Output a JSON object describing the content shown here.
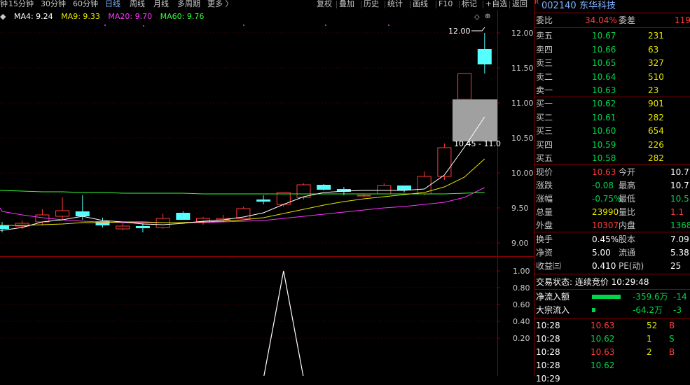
{
  "toolbar": {
    "left_items": [
      "钟",
      "15分钟",
      "30分钟",
      "60分钟",
      "日线",
      "周线",
      "月线",
      "多周期",
      "更多 〉"
    ],
    "active_item": "日线",
    "right_items": [
      "复权",
      "叠加",
      "历史",
      "统计",
      "画线",
      "F10",
      "标记",
      "+自选",
      "返回"
    ]
  },
  "legend": {
    "ma4": "MA4: 9.24",
    "ma9": "MA9: 9.33",
    "ma20": "MA20: 9.70",
    "ma60": "MA60: 9.76",
    "colors": {
      "ma4": "#ffffff",
      "ma9": "#e6e600",
      "ma20": "#ff33ff",
      "ma60": "#33ff33"
    }
  },
  "price_axis": [
    "12.00",
    "11.50",
    "11.00",
    "10.50",
    "10.00",
    "9.50",
    "9.00"
  ],
  "price_range": [
    8.95,
    12.14
  ],
  "vol_axis": [
    "1.00",
    "0.80",
    "0.60",
    "0.40",
    "0.20"
  ],
  "annotations": {
    "high_label": "12.00",
    "range_label": "10.45 - 11.0"
  },
  "chart_data": {
    "type": "candlestick",
    "candles": [
      {
        "o": 9.25,
        "h": 9.3,
        "l": 9.15,
        "c": 9.2
      },
      {
        "o": 9.24,
        "h": 9.32,
        "l": 9.2,
        "c": 9.28
      },
      {
        "o": 9.3,
        "h": 9.48,
        "l": 9.25,
        "c": 9.4
      },
      {
        "o": 9.38,
        "h": 9.65,
        "l": 9.33,
        "c": 9.46
      },
      {
        "o": 9.45,
        "h": 9.68,
        "l": 9.33,
        "c": 9.38
      },
      {
        "o": 9.31,
        "h": 9.36,
        "l": 9.22,
        "c": 9.25
      },
      {
        "o": 9.2,
        "h": 9.28,
        "l": 9.18,
        "c": 9.24
      },
      {
        "o": 9.24,
        "h": 9.28,
        "l": 9.15,
        "c": 9.21
      },
      {
        "o": 9.22,
        "h": 9.42,
        "l": 9.2,
        "c": 9.35
      },
      {
        "o": 9.43,
        "h": 9.45,
        "l": 9.33,
        "c": 9.33
      },
      {
        "o": 9.3,
        "h": 9.37,
        "l": 9.26,
        "c": 9.35
      },
      {
        "o": 9.33,
        "h": 9.4,
        "l": 9.3,
        "c": 9.35
      },
      {
        "o": 9.35,
        "h": 9.52,
        "l": 9.35,
        "c": 9.49
      },
      {
        "o": 9.62,
        "h": 9.68,
        "l": 9.55,
        "c": 9.59
      },
      {
        "o": 9.55,
        "h": 9.72,
        "l": 9.52,
        "c": 9.72
      },
      {
        "o": 9.65,
        "h": 9.85,
        "l": 9.62,
        "c": 9.83
      },
      {
        "o": 9.83,
        "h": 9.84,
        "l": 9.75,
        "c": 9.76
      },
      {
        "o": 9.77,
        "h": 9.8,
        "l": 9.68,
        "c": 9.73
      },
      {
        "o": 9.67,
        "h": 9.7,
        "l": 9.65,
        "c": 9.68
      },
      {
        "o": 9.7,
        "h": 9.85,
        "l": 9.7,
        "c": 9.82
      },
      {
        "o": 9.82,
        "h": 9.82,
        "l": 9.72,
        "c": 9.75
      },
      {
        "o": 9.7,
        "h": 10.02,
        "l": 9.68,
        "c": 9.95
      },
      {
        "o": 9.95,
        "h": 10.42,
        "l": 9.9,
        "c": 10.36
      },
      {
        "o": 11.05,
        "h": 11.42,
        "l": 11.05,
        "c": 11.42
      },
      {
        "o": 11.77,
        "h": 12.0,
        "l": 11.42,
        "c": 11.55
      }
    ],
    "ma4": [
      9.18,
      9.22,
      9.3,
      9.33,
      9.38,
      9.32,
      9.3,
      9.27,
      9.26,
      9.28,
      9.31,
      9.33,
      9.37,
      9.43,
      9.55,
      9.66,
      9.72,
      9.74,
      9.75,
      9.75,
      9.75,
      9.77,
      9.97,
      10.37,
      10.8
    ],
    "ma9": [
      9.25,
      9.25,
      9.26,
      9.27,
      9.29,
      9.29,
      9.3,
      9.3,
      9.29,
      9.29,
      9.3,
      9.31,
      9.33,
      9.36,
      9.42,
      9.48,
      9.54,
      9.59,
      9.63,
      9.66,
      9.69,
      9.72,
      9.8,
      9.94,
      10.2
    ],
    "ma20": [
      9.45,
      9.4,
      9.36,
      9.33,
      9.31,
      9.3,
      9.29,
      9.29,
      9.29,
      9.29,
      9.29,
      9.3,
      9.31,
      9.32,
      9.35,
      9.38,
      9.41,
      9.44,
      9.47,
      9.5,
      9.52,
      9.55,
      9.58,
      9.65,
      9.79
    ],
    "ma60": [
      9.75,
      9.74,
      9.73,
      9.73,
      9.72,
      9.72,
      9.71,
      9.71,
      9.71,
      9.71,
      9.7,
      9.7,
      9.7,
      9.7,
      9.7,
      9.7,
      9.7,
      9.7,
      9.7,
      9.7,
      9.7,
      9.7,
      9.7,
      9.71,
      9.72
    ],
    "intraday_box": {
      "low": 10.45,
      "high": 11.05
    },
    "indicator": [
      0,
      0,
      0,
      0,
      0,
      0,
      0,
      0,
      0,
      0,
      0,
      0,
      0,
      0,
      1.0,
      0,
      0,
      0,
      0,
      0,
      0,
      0,
      0,
      0,
      0
    ]
  },
  "panel": {
    "stock_mark": "R",
    "stock_code": "002140",
    "stock_name": "东华科技",
    "weibi_label": "委比",
    "weibi_value": "34.04%",
    "weicha_label": "委差",
    "weicha_value": "119",
    "sells": [
      {
        "label": "卖五",
        "price": "10.67",
        "vol": "231"
      },
      {
        "label": "卖四",
        "price": "10.66",
        "vol": "63"
      },
      {
        "label": "卖三",
        "price": "10.65",
        "vol": "327"
      },
      {
        "label": "卖二",
        "price": "10.64",
        "vol": "510"
      },
      {
        "label": "卖一",
        "price": "10.63",
        "vol": "23"
      }
    ],
    "buys": [
      {
        "label": "买一",
        "price": "10.62",
        "vol": "901"
      },
      {
        "label": "买二",
        "price": "10.61",
        "vol": "282"
      },
      {
        "label": "买三",
        "price": "10.60",
        "vol": "654"
      },
      {
        "label": "买四",
        "price": "10.59",
        "vol": "226"
      },
      {
        "label": "买五",
        "price": "10.58",
        "vol": "282"
      }
    ],
    "stats": [
      {
        "l1": "现价",
        "v1": "10.63",
        "c1": "red",
        "l2": "今开",
        "v2": "10.7",
        "c2": "white"
      },
      {
        "l1": "涨跌",
        "v1": "-0.08",
        "c1": "green",
        "l2": "最高",
        "v2": "10.7",
        "c2": "white"
      },
      {
        "l1": "涨幅",
        "v1": "-0.75%",
        "c1": "green",
        "l2": "最低",
        "v2": "10.5",
        "c2": "green"
      },
      {
        "l1": "总量",
        "v1": "23990",
        "c1": "yellow",
        "l2": "量比",
        "v2": "1.1",
        "c2": "red"
      },
      {
        "l1": "外盘",
        "v1": "10307",
        "c1": "red",
        "l2": "内盘",
        "v2": "1368",
        "c2": "green"
      }
    ],
    "stats2": [
      {
        "l1": "换手",
        "v1": "0.45%",
        "c1": "white",
        "l2": "股本",
        "v2": "7.09",
        "c2": "white"
      },
      {
        "l1": "净资",
        "v1": "5.00",
        "c1": "white",
        "l2": "流通",
        "v2": "5.38",
        "c2": "white"
      },
      {
        "l1": "收益㈢",
        "v1": "0.410",
        "c1": "white",
        "l2": "PE(动)",
        "v2": "25",
        "c2": "white"
      }
    ],
    "trade_status": "交易状态: 连续竞价 10:29:48",
    "flows": [
      {
        "label": "净流入额",
        "value": "-359.6万",
        "extra": "-14",
        "bar": 0.9
      },
      {
        "label": "大宗流入",
        "value": "-64.2万",
        "extra": "-3",
        "bar": 0.1
      }
    ],
    "ticks": [
      {
        "time": "10:28",
        "price": "10.63",
        "vol": "52",
        "flag": "B"
      },
      {
        "time": "10:28",
        "price": "10.62",
        "vol": "1",
        "flag": "S"
      },
      {
        "time": "10:28",
        "price": "10.63",
        "vol": "2",
        "flag": "B"
      },
      {
        "time": "10:28",
        "price": "10.62",
        "vol": "",
        "flag": ""
      },
      {
        "time": "10:29",
        "price": "",
        "vol": "",
        "flag": ""
      }
    ]
  }
}
